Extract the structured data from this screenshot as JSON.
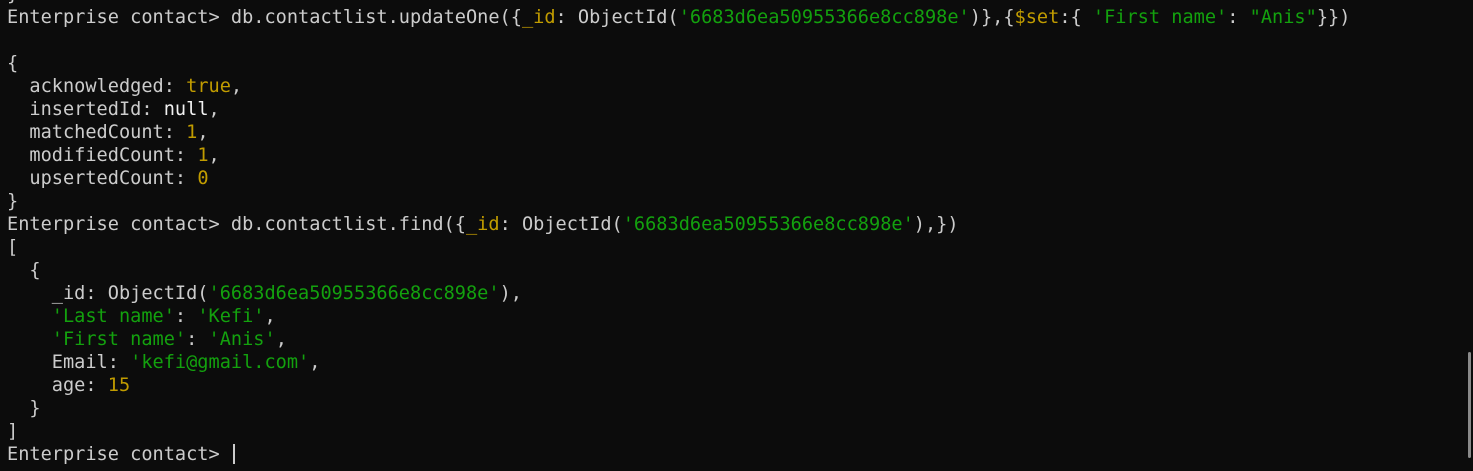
{
  "terminal": {
    "prompt": "Enterprise contact> ",
    "lines": [
      [
        {
          "t": "}",
          "c": "w"
        }
      ],
      [
        {
          "t": "Enterprise contact> ",
          "c": "w"
        },
        {
          "t": "db.contactlist.updateOne({",
          "c": "w"
        },
        {
          "t": "_id",
          "c": "y"
        },
        {
          "t": ": ObjectId(",
          "c": "w"
        },
        {
          "t": "'6683d6ea50955366e8cc898e'",
          "c": "g"
        },
        {
          "t": ")},{",
          "c": "w"
        },
        {
          "t": "$set",
          "c": "y"
        },
        {
          "t": ":{ ",
          "c": "w"
        },
        {
          "t": "'First name'",
          "c": "g"
        },
        {
          "t": ": ",
          "c": "w"
        },
        {
          "t": "\"Anis\"",
          "c": "g"
        },
        {
          "t": "}})",
          "c": "w"
        }
      ],
      [],
      [
        {
          "t": "{",
          "c": "w"
        }
      ],
      [
        {
          "t": "  acknowledged: ",
          "c": "w"
        },
        {
          "t": "true",
          "c": "y"
        },
        {
          "t": ",",
          "c": "w"
        }
      ],
      [
        {
          "t": "  insertedId: ",
          "c": "w"
        },
        {
          "t": "null",
          "c": "b"
        },
        {
          "t": ",",
          "c": "w"
        }
      ],
      [
        {
          "t": "  matchedCount: ",
          "c": "w"
        },
        {
          "t": "1",
          "c": "y"
        },
        {
          "t": ",",
          "c": "w"
        }
      ],
      [
        {
          "t": "  modifiedCount: ",
          "c": "w"
        },
        {
          "t": "1",
          "c": "y"
        },
        {
          "t": ",",
          "c": "w"
        }
      ],
      [
        {
          "t": "  upsertedCount: ",
          "c": "w"
        },
        {
          "t": "0",
          "c": "y"
        }
      ],
      [
        {
          "t": "}",
          "c": "w"
        }
      ],
      [
        {
          "t": "Enterprise contact> ",
          "c": "w"
        },
        {
          "t": "db.contactlist.find({",
          "c": "w"
        },
        {
          "t": "_id",
          "c": "y"
        },
        {
          "t": ": ObjectId(",
          "c": "w"
        },
        {
          "t": "'6683d6ea50955366e8cc898e'",
          "c": "g"
        },
        {
          "t": "),})",
          "c": "w"
        }
      ],
      [
        {
          "t": "[",
          "c": "w"
        }
      ],
      [
        {
          "t": "  {",
          "c": "w"
        }
      ],
      [
        {
          "t": "    _id: ObjectId(",
          "c": "w"
        },
        {
          "t": "'6683d6ea50955366e8cc898e'",
          "c": "g"
        },
        {
          "t": "),",
          "c": "w"
        }
      ],
      [
        {
          "t": "    ",
          "c": "w"
        },
        {
          "t": "'Last name'",
          "c": "g"
        },
        {
          "t": ": ",
          "c": "w"
        },
        {
          "t": "'Kefi'",
          "c": "g"
        },
        {
          "t": ",",
          "c": "w"
        }
      ],
      [
        {
          "t": "    ",
          "c": "w"
        },
        {
          "t": "'First name'",
          "c": "g"
        },
        {
          "t": ": ",
          "c": "w"
        },
        {
          "t": "'Anis'",
          "c": "g"
        },
        {
          "t": ",",
          "c": "w"
        }
      ],
      [
        {
          "t": "    Email: ",
          "c": "w"
        },
        {
          "t": "'kefi@gmail.com'",
          "c": "g"
        },
        {
          "t": ",",
          "c": "w"
        }
      ],
      [
        {
          "t": "    age: ",
          "c": "w"
        },
        {
          "t": "15",
          "c": "y"
        }
      ],
      [
        {
          "t": "  }",
          "c": "w"
        }
      ],
      [
        {
          "t": "]",
          "c": "w"
        }
      ],
      [
        {
          "t": "Enterprise contact> ",
          "c": "w"
        }
      ]
    ]
  },
  "colors": {
    "background": "#0c0c0c",
    "text": "#cccccc",
    "bright": "#f2f2f2",
    "string": "#13a10e",
    "keyword": "#c19c00"
  }
}
